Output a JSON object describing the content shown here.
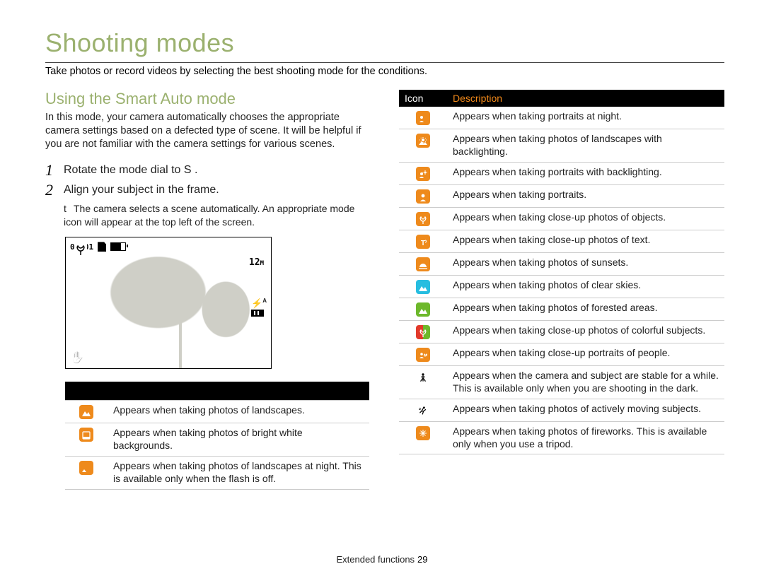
{
  "title": "Shooting modes",
  "subtitle": "Take photos or record videos by selecting the best shooting mode for the conditions.",
  "left": {
    "heading": "Using the Smart Auto mode",
    "paragraph": "In this mode, your camera automatically chooses the appropriate camera settings based on a defected type of scene. It will be helpful if you are not familiar with the camera settings for various scenes.",
    "step1_num": "1",
    "step1": "Rotate the mode dial to S       .",
    "step2_num": "2",
    "step2": "Align your subject in the frame.",
    "substep_marker": "t",
    "substep": "The camera selects a scene automatically. An appropriate mode icon will appear at the top left of the screen.",
    "cam": {
      "counter": "00001",
      "mp": "12",
      "mp_suffix": "M",
      "flash_mode": "A"
    },
    "table": [
      {
        "icon": "landscape",
        "desc": "Appears when taking photos of landscapes."
      },
      {
        "icon": "white",
        "desc": "Appears when taking photos of bright white backgrounds."
      },
      {
        "icon": "night-land",
        "desc": "Appears when taking photos of landscapes at night. This is available only when the ﬂash is off."
      }
    ]
  },
  "right": {
    "header_icon": "Icon",
    "header_desc": "Description",
    "rows": [
      {
        "icon": "night-portrait",
        "cls": "o",
        "desc": "Appears when taking portraits at night."
      },
      {
        "icon": "backlit-land",
        "cls": "o",
        "desc": "Appears when taking photos of landscapes with backlighting."
      },
      {
        "icon": "backlit-portrait",
        "cls": "o",
        "desc": "Appears when taking portraits with backlighting."
      },
      {
        "icon": "portrait",
        "cls": "o",
        "desc": "Appears when taking portraits."
      },
      {
        "icon": "macro-object",
        "cls": "o",
        "desc": "Appears when taking close-up photos of objects."
      },
      {
        "icon": "macro-text",
        "cls": "o",
        "desc": "Appears when taking close-up photos of text."
      },
      {
        "icon": "sunset",
        "cls": "o",
        "desc": "Appears when taking photos of sunsets."
      },
      {
        "icon": "sky",
        "cls": "c",
        "desc": "Appears when taking photos of clear skies."
      },
      {
        "icon": "forest",
        "cls": "g",
        "desc": "Appears when taking photos of forested areas."
      },
      {
        "icon": "macro-color",
        "cls": "redg",
        "desc": "Appears when taking close-up photos of colorful subjects."
      },
      {
        "icon": "macro-portrait",
        "cls": "o",
        "desc": "Appears when taking close-up portraits of people."
      },
      {
        "icon": "tripod",
        "cls": "k",
        "desc": "Appears when the camera and subject are stable for a while. This is available only when you are shooting in the dark."
      },
      {
        "icon": "action",
        "cls": "k",
        "desc": "Appears when taking photos of actively moving subjects."
      },
      {
        "icon": "fireworks",
        "cls": "o",
        "desc": "Appears when taking photos of ﬁreworks. This is available only when you use a tripod."
      }
    ]
  },
  "footer": {
    "section": "Extended functions",
    "page": "29"
  }
}
